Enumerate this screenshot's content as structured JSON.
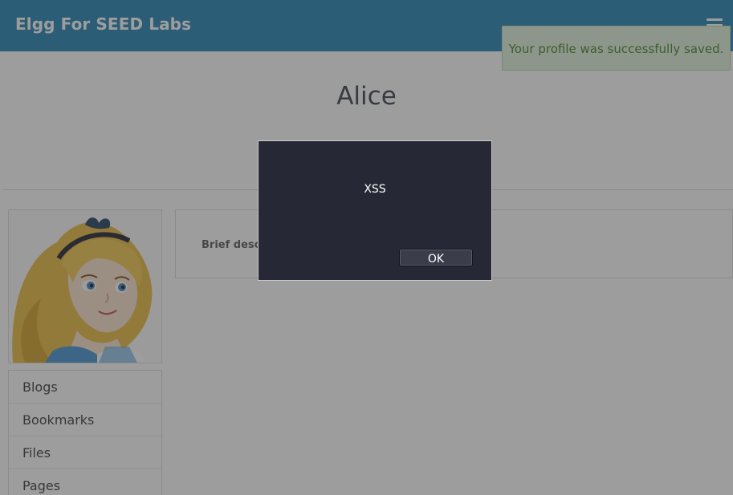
{
  "header": {
    "site_title": "Elgg For SEED Labs",
    "menu_icon": "hamburger-menu-icon"
  },
  "system_message": {
    "text": "Your profile was successfully saved."
  },
  "profile": {
    "name": "Alice",
    "brief_description_label": "Brief descri",
    "avatar": "alice-avatar-image"
  },
  "owner_menu": {
    "items": [
      {
        "label": "Blogs"
      },
      {
        "label": "Bookmarks"
      },
      {
        "label": "Files"
      },
      {
        "label": "Pages"
      }
    ]
  },
  "alert": {
    "message": "XSS",
    "ok_label": "OK"
  },
  "colors": {
    "topbar": "#1a7fb1",
    "alert_bg": "#262835",
    "success_bg": "#dff0d8"
  }
}
